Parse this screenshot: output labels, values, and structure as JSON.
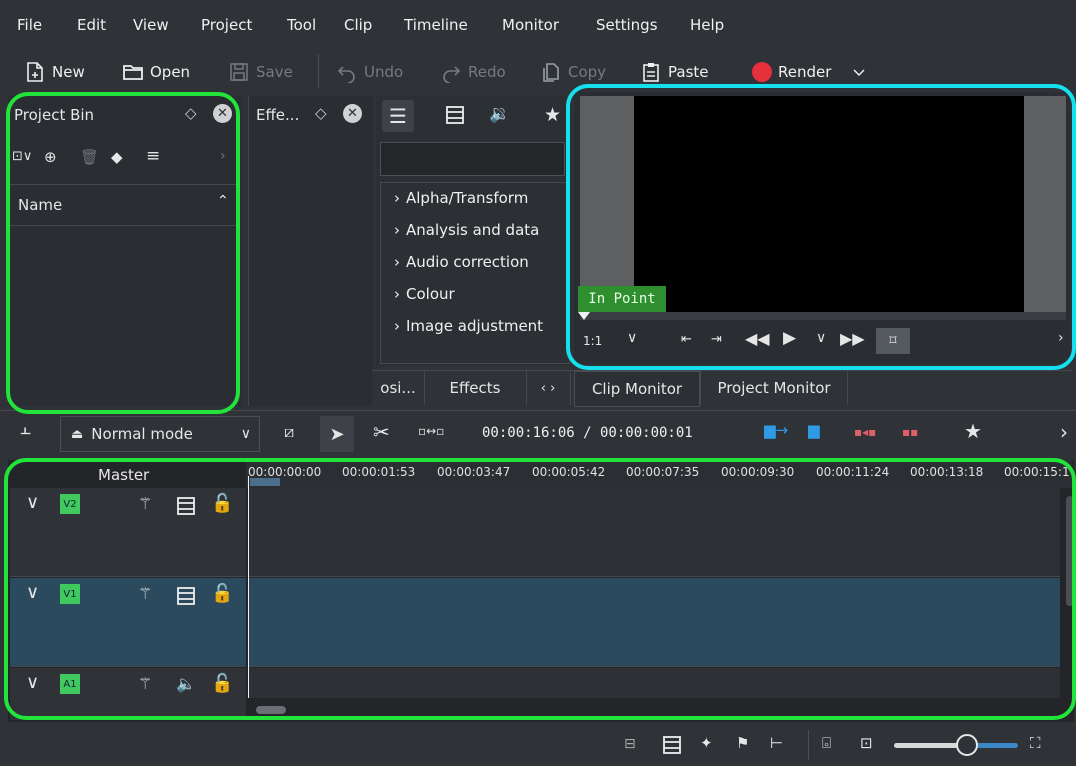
{
  "menu": [
    "File",
    "Edit",
    "View",
    "Project",
    "Tool",
    "Clip",
    "Timeline",
    "Monitor",
    "Settings",
    "Help"
  ],
  "toolbar": {
    "new": "New",
    "open": "Open",
    "save": "Save",
    "undo": "Undo",
    "redo": "Redo",
    "copy": "Copy",
    "paste": "Paste",
    "render": "Render"
  },
  "project_bin": {
    "title": "Project Bin",
    "name_header": "Name"
  },
  "effects_dock": {
    "title": "Effe...",
    "search_value": "",
    "categories": [
      "Alpha/Transform",
      "Analysis and data",
      "Audio correction",
      "Colour",
      "Image adjustment"
    ]
  },
  "monitor": {
    "in_point": "In Point",
    "zoom": "1:1"
  },
  "tabs": {
    "compositions_short": "osi...",
    "effects": "Effects",
    "clip_monitor": "Clip Monitor",
    "project_monitor": "Project Monitor"
  },
  "timeline_toolbar": {
    "mode": "Normal mode",
    "timecode": "00:00:16:06 / 00:00:00:01"
  },
  "timeline": {
    "master": "Master",
    "ruler": [
      "00:00:00:00",
      "00:00:01:53",
      "00:00:03:47",
      "00:00:05:42",
      "00:00:07:35",
      "00:00:09:30",
      "00:00:11:24",
      "00:00:13:18",
      "00:00:15:1"
    ],
    "tracks": [
      {
        "id": "V2",
        "type": "video"
      },
      {
        "id": "V1",
        "type": "video"
      },
      {
        "id": "A1",
        "type": "audio"
      }
    ]
  },
  "colors": {
    "highlight_green": "#22e33a",
    "highlight_cyan": "#14e0ee",
    "render_red": "#e5303b",
    "selected_track": "#2b4a5d",
    "in_point_bg": "#2f8f2f"
  }
}
